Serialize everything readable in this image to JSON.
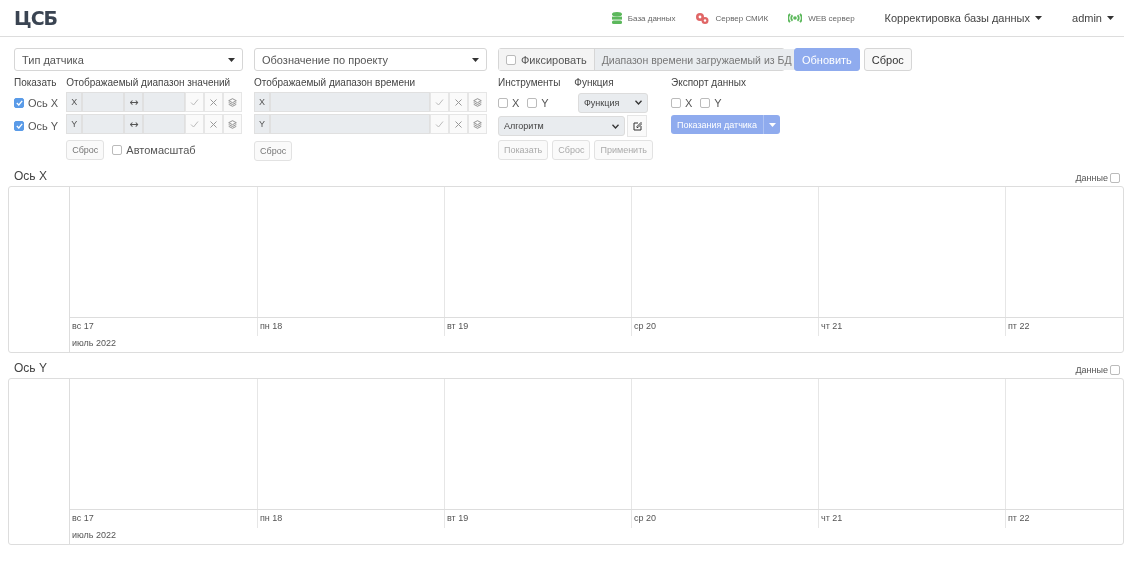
{
  "header": {
    "logo": "ЦСБ",
    "status": [
      {
        "label": "База данных",
        "kind": "database",
        "color": "#5cb85c"
      },
      {
        "label": "Сервер СМИК",
        "kind": "gears",
        "color": "#e06666"
      },
      {
        "label": "WEB сервер",
        "kind": "broadcast",
        "color": "#5cb85c"
      }
    ],
    "menus": [
      {
        "label": "Корректировка базы данных"
      },
      {
        "label": "admin"
      }
    ]
  },
  "filters": {
    "sensor_type": {
      "placeholder": "Тип датчика"
    },
    "project": {
      "placeholder": "Обозначение по проекту"
    },
    "fix": {
      "label": "Фиксировать",
      "checked": false
    },
    "range_field": {
      "value": "Диапазон времени загружаемый из БД"
    },
    "buttons": [
      {
        "label": "Обновить",
        "kind": "primary",
        "disabled": true
      },
      {
        "label": "Сброс",
        "kind": "secondary",
        "disabled": false
      }
    ]
  },
  "show": {
    "heading": "Показать",
    "axes": [
      {
        "label": "Ось X",
        "checked": true
      },
      {
        "label": "Ось Y",
        "checked": true
      }
    ]
  },
  "value_range": {
    "heading": "Отображаемый диапазон значений",
    "rows": [
      {
        "axis": "X",
        "separator": "↔"
      },
      {
        "axis": "Y",
        "separator": "↔"
      }
    ],
    "reset": "Сброс",
    "autoscale": {
      "label": "Автомасштаб",
      "checked": false
    }
  },
  "time_range": {
    "heading": "Отображаемый диапазон времени",
    "rows": [
      {
        "axis": "X"
      },
      {
        "axis": "Y"
      }
    ],
    "reset": "Сброс"
  },
  "tools": {
    "heading": "Инструменты",
    "checks": [
      {
        "label": "X",
        "checked": false
      },
      {
        "label": "Y",
        "checked": false
      }
    ],
    "algorithm": {
      "placeholder": "Алгоритм"
    },
    "buttons": [
      {
        "label": "Показать",
        "disabled": true
      },
      {
        "label": "Сброс",
        "disabled": true
      },
      {
        "label": "Применить",
        "disabled": true
      }
    ]
  },
  "function": {
    "heading": "Функция",
    "select": "Функция"
  },
  "export": {
    "heading": "Экспорт данных",
    "checks": [
      {
        "label": "X",
        "checked": false
      },
      {
        "label": "Y",
        "checked": false
      }
    ],
    "button": "Показания датчика"
  },
  "charts": [
    {
      "title": "Ось X",
      "data_label": "Данные",
      "data_checked": false,
      "days": [
        "вс 17",
        "пн 18",
        "вт 19",
        "ср 20",
        "чт 21",
        "пт 22"
      ],
      "month": "июль 2022"
    },
    {
      "title": "Ось Y",
      "data_label": "Данные",
      "data_checked": false,
      "days": [
        "вс 17",
        "пн 18",
        "вт 19",
        "ср 20",
        "чт 21",
        "пт 22"
      ],
      "month": "июль 2022"
    }
  ]
}
